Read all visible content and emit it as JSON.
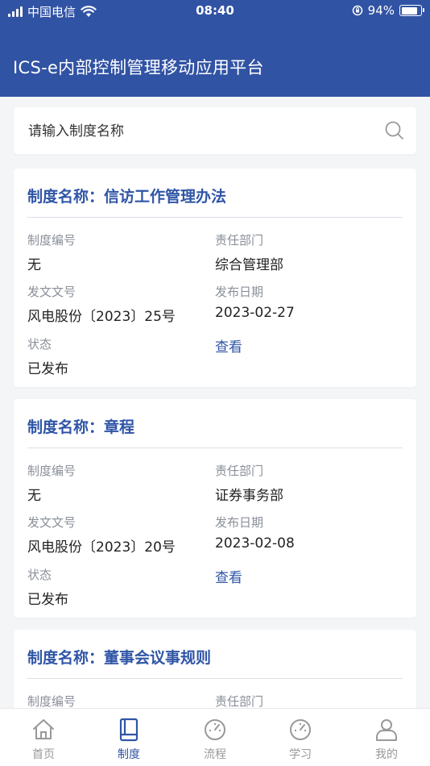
{
  "status_bar": {
    "carrier": "中国电信",
    "time": "08:40",
    "battery": "94%",
    "battery_level": 0.94
  },
  "header": {
    "title": "ICS-e内部控制管理移动应用平台"
  },
  "search": {
    "placeholder": "请输入制度名称"
  },
  "cards": [
    {
      "title": "制度名称：信访工作管理办法",
      "code_label": "制度编号",
      "code": "无",
      "dept_label": "责任部门",
      "dept": "综合管理部",
      "doc_label": "发文文号",
      "doc": "风电股份〔2023〕25号",
      "date_label": "发布日期",
      "date": "2023-02-27",
      "status_label": "状态",
      "status": "已发布",
      "view_label": "查看"
    },
    {
      "title": "制度名称：章程",
      "code_label": "制度编号",
      "code": "无",
      "dept_label": "责任部门",
      "dept": "证券事务部",
      "doc_label": "发文文号",
      "doc": "风电股份〔2023〕20号",
      "date_label": "发布日期",
      "date": "2023-02-08",
      "status_label": "状态",
      "status": "已发布",
      "view_label": "查看"
    },
    {
      "title": "制度名称：董事会议事规则",
      "code_label": "制度编号",
      "dept_label": "责任部门"
    }
  ],
  "tabs": [
    {
      "label": "首页",
      "icon": "home-icon"
    },
    {
      "label": "制度",
      "icon": "book-icon",
      "active": true
    },
    {
      "label": "流程",
      "icon": "gauge-icon"
    },
    {
      "label": "学习",
      "icon": "gauge-icon"
    },
    {
      "label": "我的",
      "icon": "user-icon"
    }
  ],
  "colors": {
    "primary": "#3153a4",
    "accent": "#2f55a6",
    "background": "#f4f5f7"
  }
}
